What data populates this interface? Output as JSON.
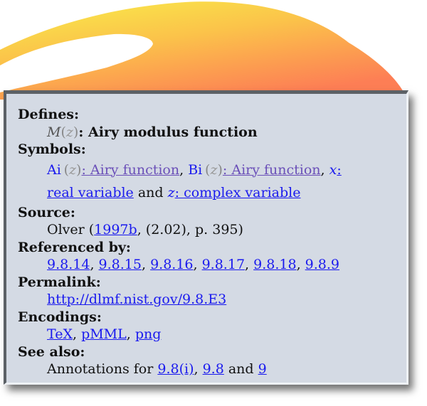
{
  "defines": {
    "label": "Defines:",
    "symbol": "M",
    "arg": "z",
    "name": "Airy modulus function"
  },
  "symbols": {
    "label": "Symbols:",
    "items": [
      {
        "fn": "Ai",
        "arg": "z",
        "link": ": Airy function"
      },
      {
        "fn": "Bi",
        "arg": "z",
        "link": ": Airy function"
      },
      {
        "var": "x",
        "link": ":",
        "link2": "real variable"
      },
      {
        "var": "z",
        "link": ": complex variable"
      }
    ],
    "and": "and"
  },
  "source": {
    "label": "Source:",
    "author": "Olver (",
    "ref": "1997b",
    "rest": ", (2.02), p. 395)"
  },
  "referenced_by": {
    "label": "Referenced by:",
    "links": [
      "9.8.14",
      "9.8.15",
      "9.8.16",
      "9.8.17",
      "9.8.18",
      "9.8.9"
    ]
  },
  "permalink": {
    "label": "Permalink:",
    "url": "http://dlmf.nist.gov/9.8.E3"
  },
  "encodings": {
    "label": "Encodings:",
    "links": [
      "TeX",
      "pMML",
      "png"
    ]
  },
  "see_also": {
    "label": "See also:",
    "prefix": "Annotations for ",
    "links": [
      "9.8(i)",
      "9.8",
      "9"
    ],
    "and": "and"
  },
  "colors": {
    "panel_bg": "#d4dae4",
    "link": "#1a1aee",
    "visited_link": "#6a4fb8"
  }
}
